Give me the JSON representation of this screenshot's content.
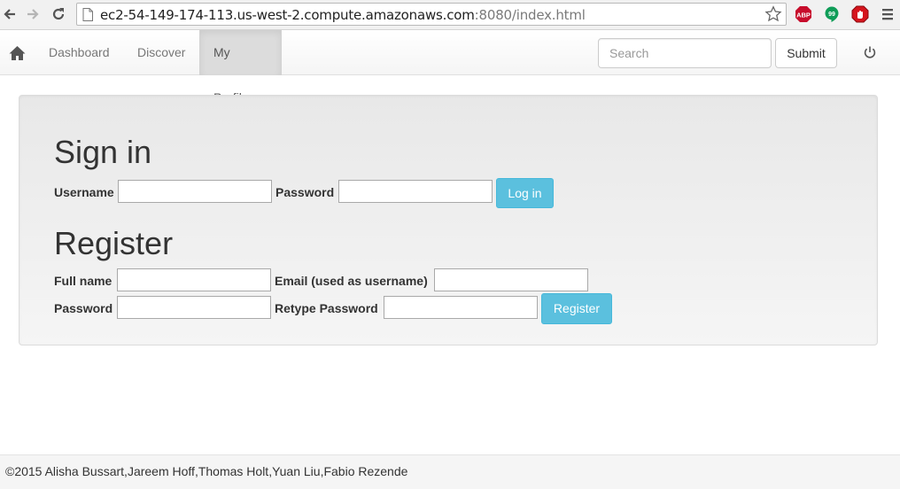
{
  "browser": {
    "url_host": "ec2-54-149-174-113.us-west-2.compute.amazonaws.com",
    "url_rest": ":8080/index.html",
    "extensions": [
      {
        "name": "adblock-plus-icon",
        "label": "ABP",
        "color": "#c70d2c"
      },
      {
        "name": "hangouts-icon",
        "label": "99",
        "color": "#0f9d58"
      },
      {
        "name": "adblock-icon",
        "label": "",
        "color": "#d5151d"
      }
    ]
  },
  "navbar": {
    "items": [
      {
        "label": "Dashboard"
      },
      {
        "label": "Discover"
      },
      {
        "label": "My Profile",
        "active": true
      }
    ],
    "search_placeholder": "Search",
    "submit_label": "Submit"
  },
  "signin": {
    "title": "Sign in",
    "username_label": "Username",
    "username_value": "",
    "password_label": "Password",
    "password_value": "",
    "login_label": "Log in"
  },
  "register": {
    "title": "Register",
    "fullname_label": "Full name",
    "fullname_value": "",
    "email_label": "Email (used as username)",
    "email_value": "",
    "password_label": "Password",
    "password_value": "",
    "retype_label": "Retype Password",
    "retype_value": "",
    "register_label": "Register"
  },
  "colors": {
    "accent": "#5bc0de",
    "active_tab_bg": "#dcdcdc"
  },
  "footer": {
    "text": "©2015 Alisha Bussart,Jareem Hoff,Thomas Holt,Yuan Liu,Fabio Rezende"
  }
}
